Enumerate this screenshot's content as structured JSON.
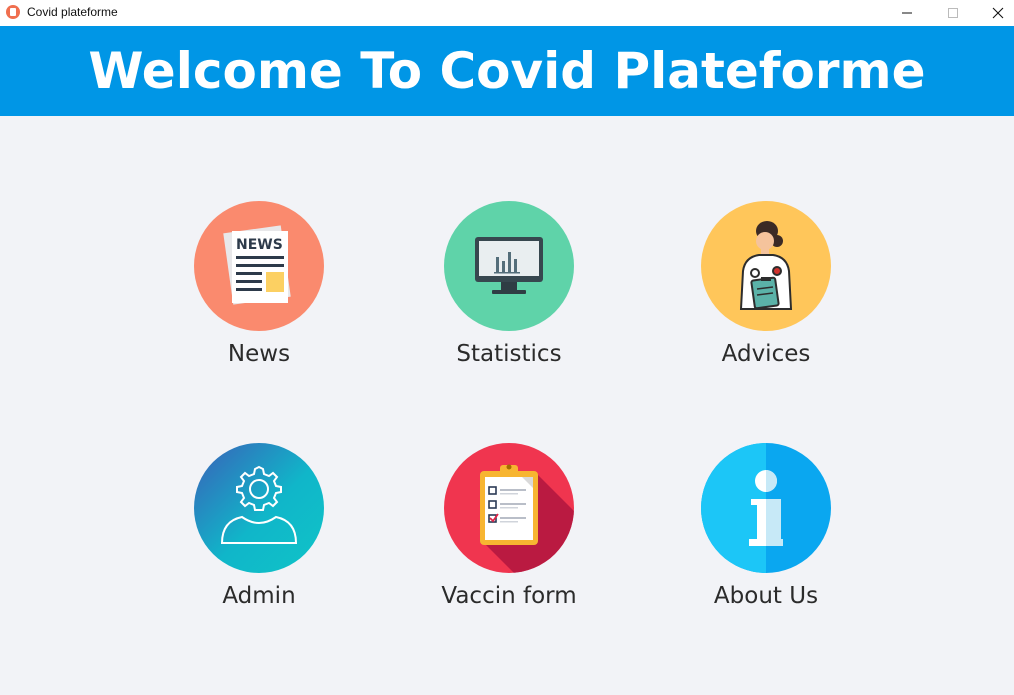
{
  "window": {
    "title": "Covid plateforme",
    "controls": {
      "minimize_icon": "minimize-icon",
      "maximize_icon": "maximize-icon",
      "close_icon": "close-icon"
    }
  },
  "header": {
    "title": "Welcome To Covid Plateforme",
    "background": "#0096e6"
  },
  "menu": {
    "items": [
      {
        "label": "News",
        "icon": "newspaper-icon",
        "color": "#fa8a6e"
      },
      {
        "label": "Statistics",
        "icon": "monitor-chart-icon",
        "color": "#5fd3a9"
      },
      {
        "label": "Advices",
        "icon": "doctor-icon",
        "color": "#ffc65a"
      },
      {
        "label": "Admin",
        "icon": "admin-gear-user-icon",
        "color": "#12b4c8"
      },
      {
        "label": "Vaccin form",
        "icon": "clipboard-checklist-icon",
        "color": "#f0354f"
      },
      {
        "label": "About Us",
        "icon": "info-icon",
        "color": "#0aa7f0"
      }
    ]
  }
}
